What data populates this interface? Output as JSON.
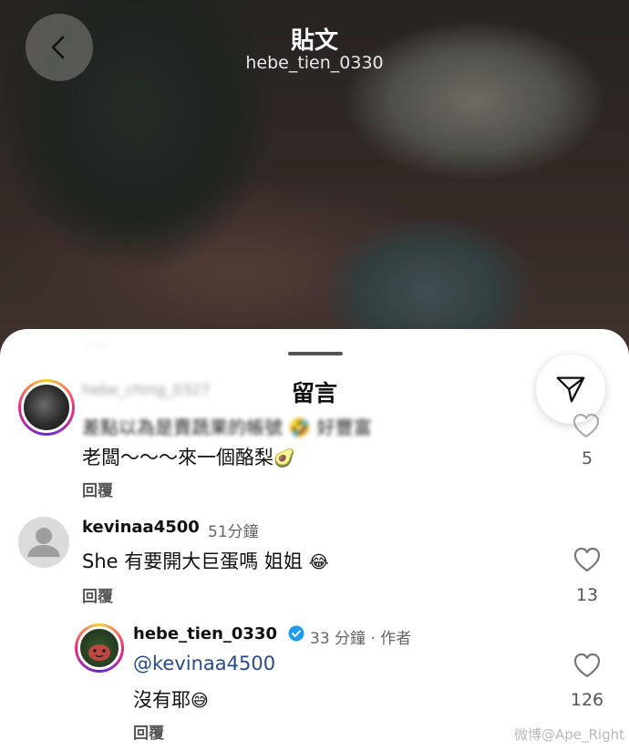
{
  "header": {
    "title": "貼文",
    "username": "hebe_tien_0330"
  },
  "sheet": {
    "title": "留言"
  },
  "comments": [
    {
      "username": "hebe_ching_0327",
      "text_blurred": "差點以為是賣蔬果的帳號",
      "text_blurred_tail": "好豐富",
      "text": "老闆～～～來一個酪梨",
      "emoji": "🥑",
      "reply_label": "回覆",
      "likes": "5"
    },
    {
      "username": "kevinaa4500",
      "time": "51分鐘",
      "text": "She 有要開大巨蛋嗎 姐姐",
      "emoji": "😂",
      "reply_label": "回覆",
      "likes": "13"
    },
    {
      "username": "hebe_tien_0330",
      "time": "33 分鐘",
      "role": "‧ 作者",
      "mention": "@kevinaa4500",
      "text": "沒有耶",
      "emoji": "😅",
      "reply_label": "回覆",
      "likes": "126"
    }
  ],
  "watermark": "微博@Ape_Right",
  "icons": {
    "back": "chevron-left-icon",
    "send": "send-icon",
    "like": "heart-icon",
    "verified": "verified-badge-icon"
  },
  "colors": {
    "mention": "#2b4a8b",
    "verified": "#1d9bf0",
    "sheet_bg": "#ffffff"
  }
}
